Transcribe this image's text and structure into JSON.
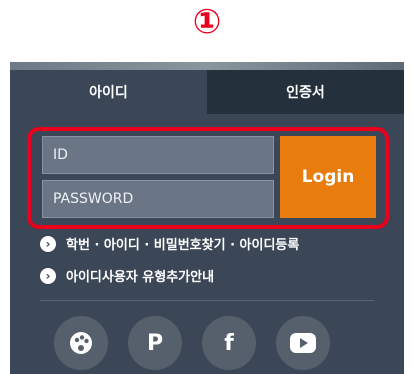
{
  "step_badge": "①",
  "tabs": [
    {
      "label": "아이디"
    },
    {
      "label": "인증서"
    }
  ],
  "login": {
    "id_placeholder": "ID",
    "password_placeholder": "PASSWORD",
    "login_label": "Login"
  },
  "links": [
    {
      "label": "학번 · 아이디 · 비밀번호찾기 · 아이디등록"
    },
    {
      "label": "아이디사용자 유형추가안내"
    }
  ],
  "social_icons": [
    "palette-icon",
    "p-icon",
    "facebook-icon",
    "youtube-icon"
  ],
  "colors": {
    "panel": "#3b4756",
    "login_button": "#e87d0d",
    "highlight": "#e8001c"
  }
}
